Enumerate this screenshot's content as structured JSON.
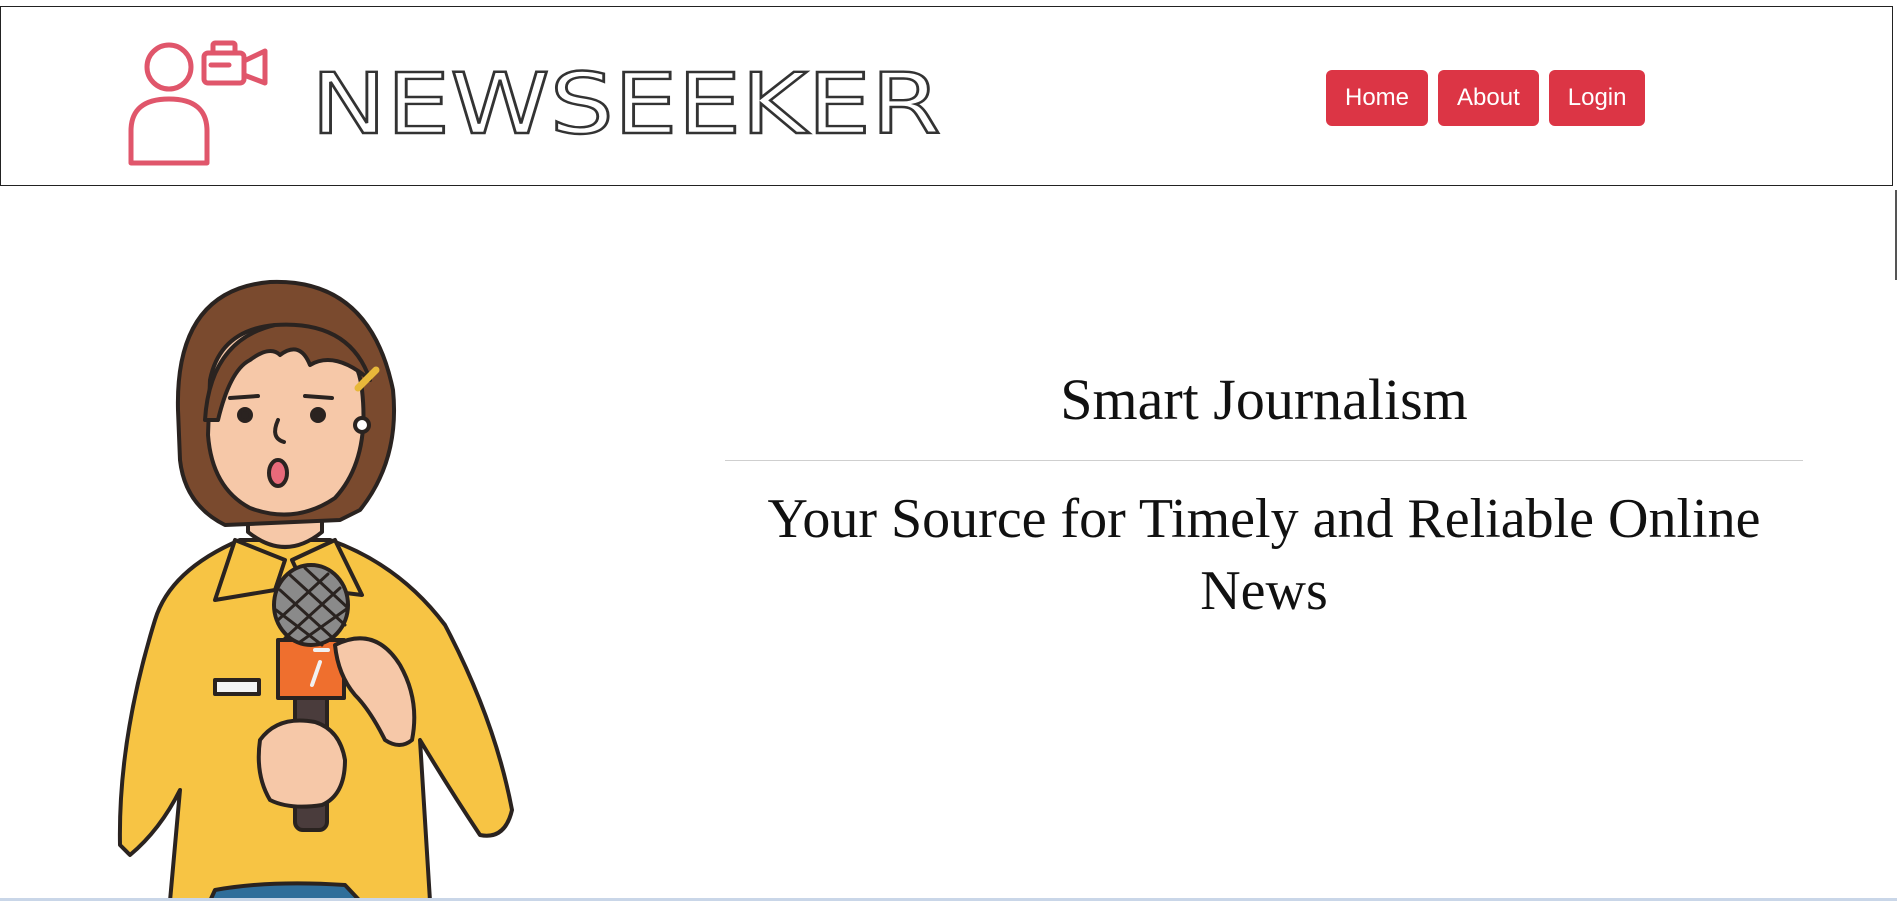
{
  "brand": {
    "name": "NEWSEEKER",
    "logo_icon": "person-with-video-camera-icon",
    "accent_color": "#dc3545"
  },
  "nav": {
    "items": [
      {
        "label": "Home"
      },
      {
        "label": "About"
      },
      {
        "label": "Login"
      }
    ]
  },
  "hero": {
    "title": "Smart Journalism",
    "subtitle": "Your Source for Timely and Reliable Online News",
    "illustration": "reporter-with-microphone-illustration"
  }
}
